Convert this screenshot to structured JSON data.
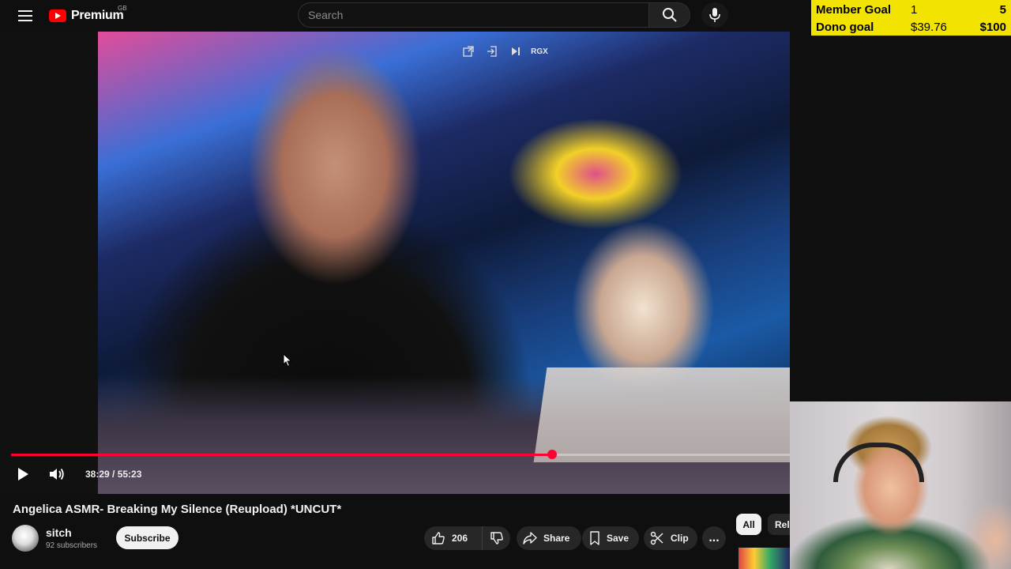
{
  "header": {
    "logo_text": "Premium",
    "region": "GB",
    "search_placeholder": "Search"
  },
  "goals": [
    {
      "label": "Member Goal",
      "current": "1",
      "target": "5"
    },
    {
      "label": "Dono goal",
      "current": "$39.76",
      "target": "$100"
    }
  ],
  "player": {
    "current_time": "38:29",
    "duration": "55:23",
    "time_display": "38:29 / 55:23",
    "progress_fraction": 0.695,
    "overlay_label": "RGX"
  },
  "video": {
    "title": "Angelica ASMR- Breaking My Silence (Reupload) *UNCUT*",
    "channel": "sitch",
    "subscribers": "92 subscribers",
    "subscribe_label": "Subscribe",
    "likes": "206",
    "share_label": "Share",
    "save_label": "Save",
    "clip_label": "Clip",
    "more_label": "..."
  },
  "chips": {
    "all": "All",
    "related": "Related"
  },
  "colors": {
    "brand_red": "#ff0000",
    "progress": "#ff0033",
    "goal_bg": "#f2e400"
  }
}
